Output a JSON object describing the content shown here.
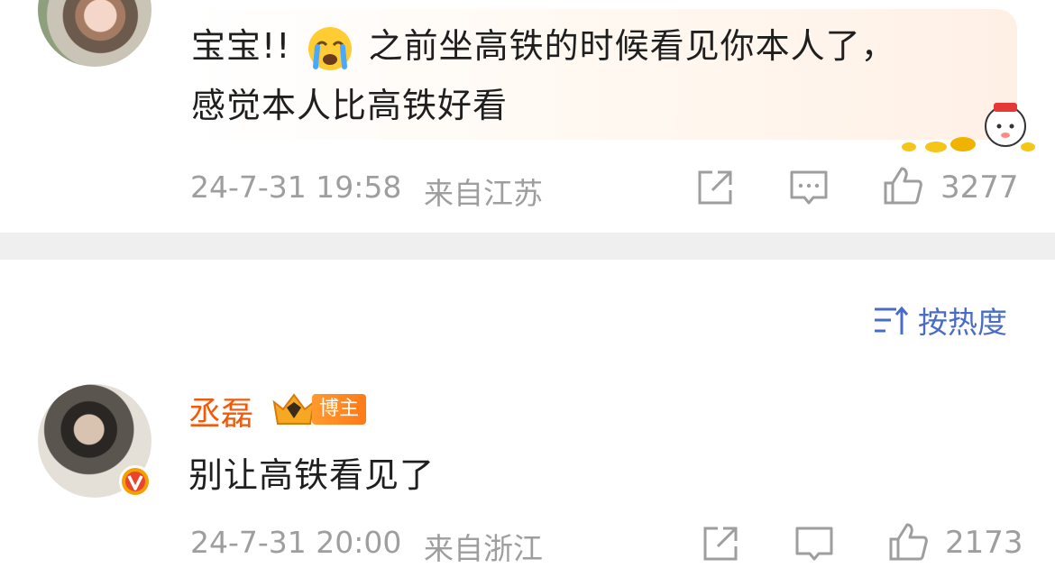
{
  "post1": {
    "text_line1_a": "宝宝!!",
    "text_line1_b": "之前坐高铁的时候看见你本人了，",
    "text_line2": "感觉本人比高铁好看",
    "emoji": "crying-face-icon",
    "time": "24-7-31 19:58",
    "location": "来自江苏",
    "likes": "3277"
  },
  "sort": {
    "label": "按热度"
  },
  "post2": {
    "username": "丞磊",
    "role_tag": "博主",
    "text": "别让高铁看见了",
    "time": "24-7-31 20:00",
    "location": "来自浙江",
    "likes": "2173"
  },
  "colors": {
    "username": "#f05a0a",
    "sort_link": "#4a6cc7",
    "meta_gray": "#9e9e9e",
    "divider": "#efefef"
  }
}
